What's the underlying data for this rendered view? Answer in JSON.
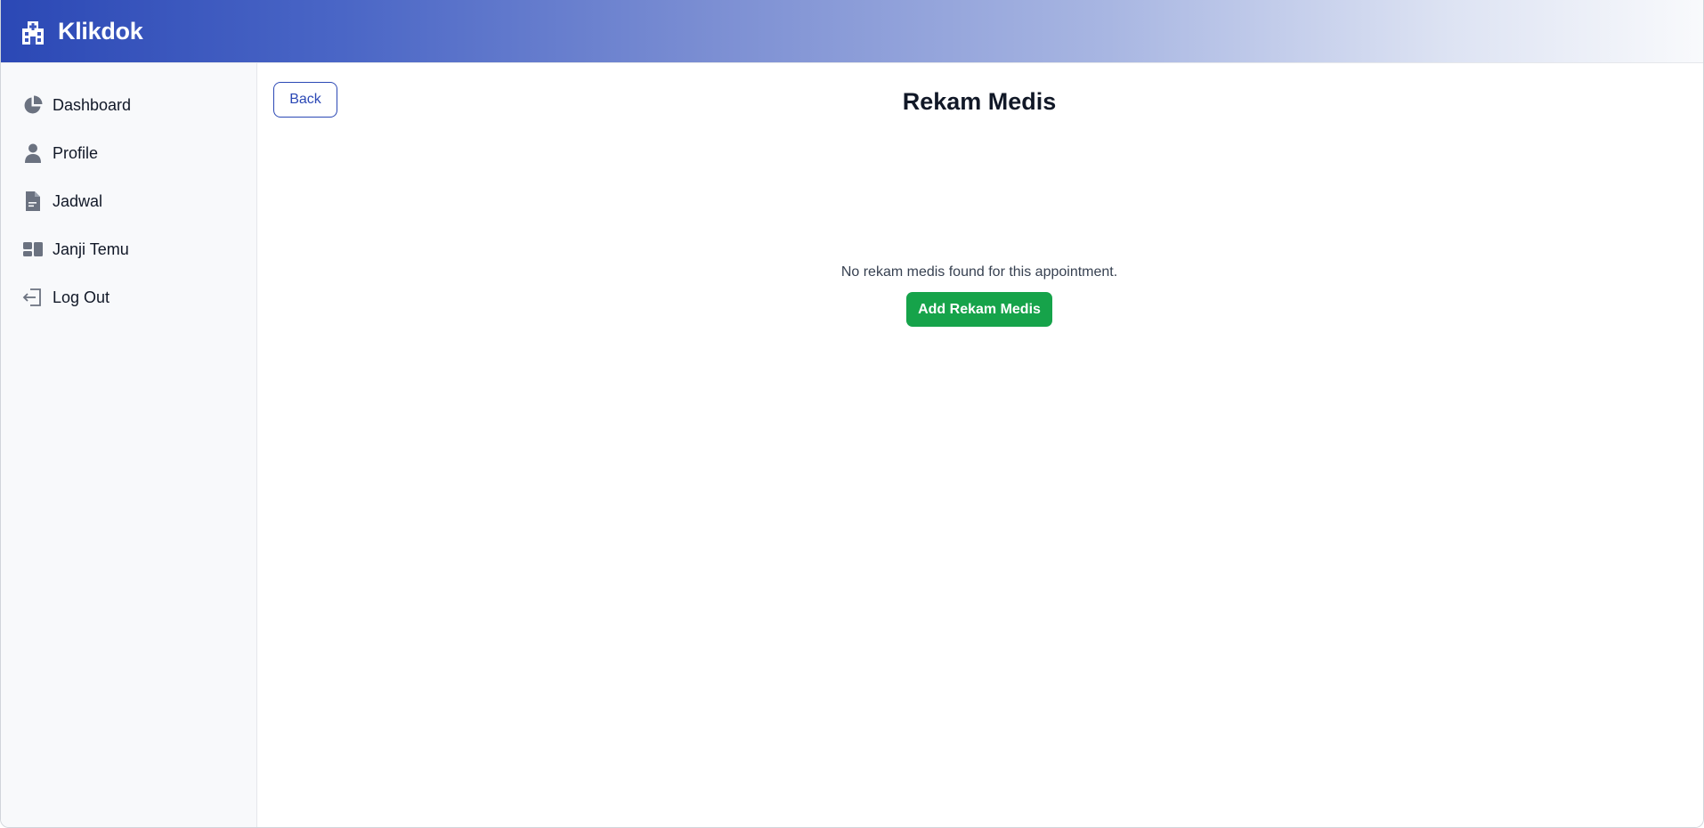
{
  "app": {
    "name": "Klikdok",
    "logo_icon": "hospital-icon",
    "accent_color": "#2b48b5"
  },
  "sidebar": {
    "items": [
      {
        "label": "Dashboard",
        "icon": "chart-pie-icon"
      },
      {
        "label": "Profile",
        "icon": "user-icon"
      },
      {
        "label": "Jadwal",
        "icon": "file-document-icon"
      },
      {
        "label": "Janji Temu",
        "icon": "grid-blocks-icon"
      },
      {
        "label": "Log Out",
        "icon": "logout-icon"
      }
    ]
  },
  "main": {
    "back_label": "Back",
    "title": "Rekam Medis",
    "empty_message": "No rekam medis found for this appointment.",
    "add_button_label": "Add Rekam Medis",
    "add_button_color": "#16a34a"
  }
}
